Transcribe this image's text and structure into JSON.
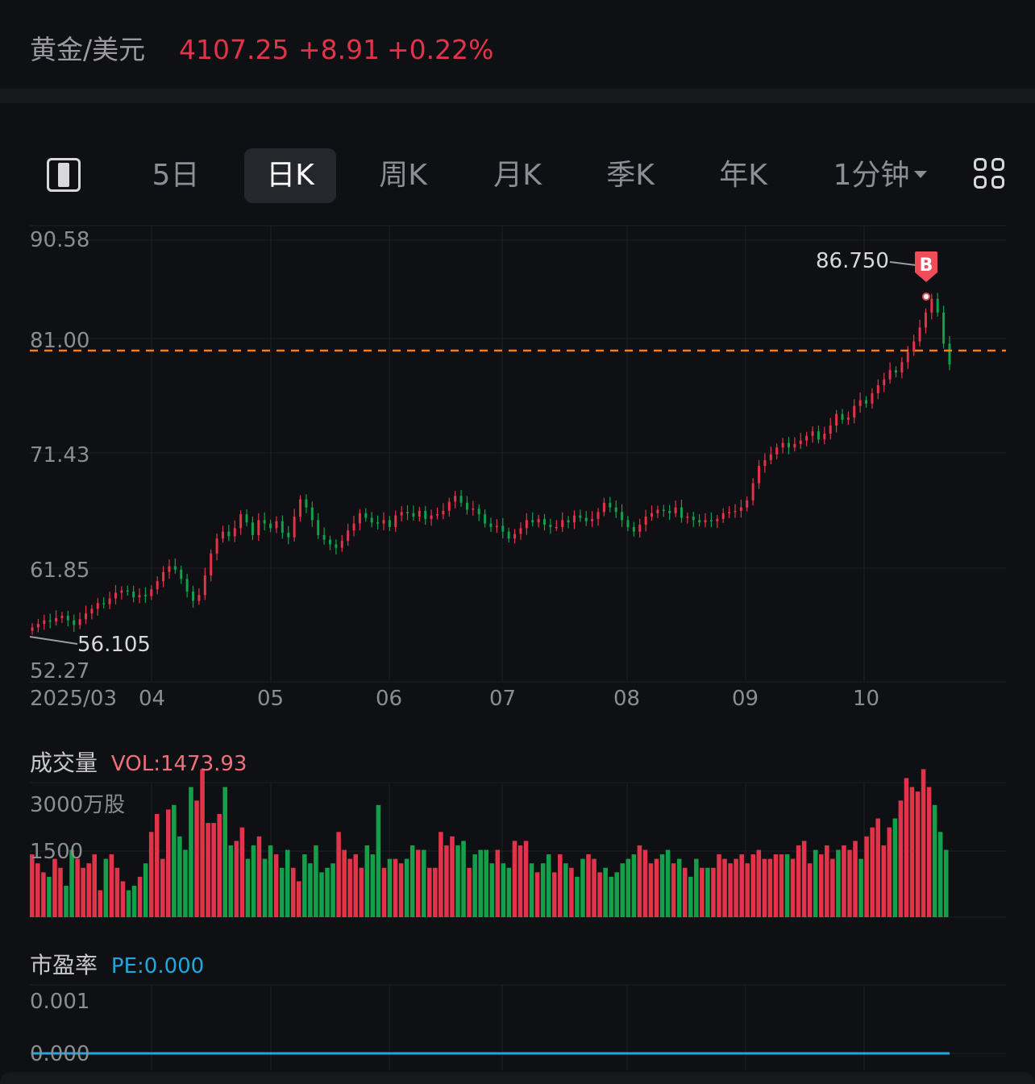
{
  "header": {
    "symbol": "黄金/美元",
    "price": "4107.25",
    "change": "+8.91",
    "change_pct": "+0.22%",
    "colors": {
      "up": "#e2334a",
      "down": "#13a04a",
      "text": "#9a9aa0"
    }
  },
  "tabs": {
    "layout_icon": "split-layout-icon",
    "items": [
      {
        "label": "5日",
        "active": false
      },
      {
        "label": "日K",
        "active": true
      },
      {
        "label": "周K",
        "active": false
      },
      {
        "label": "月K",
        "active": false
      },
      {
        "label": "季K",
        "active": false
      },
      {
        "label": "年K",
        "active": false
      },
      {
        "label": "1分钟",
        "active": false,
        "dropdown": true
      }
    ],
    "more_icon": "grid-icon"
  },
  "price_chart": {
    "y_ticks": [
      "90.58",
      "81.00",
      "71.43",
      "61.85",
      "52.27"
    ],
    "x_ticks": [
      "2025/03",
      "04",
      "05",
      "06",
      "07",
      "08",
      "09",
      "10"
    ],
    "max_label": "86.750",
    "min_label": "56.105",
    "current_line": 81.0,
    "marker": "B"
  },
  "volume": {
    "title": "成交量",
    "value_label": "VOL:1473.93",
    "y_ticks": [
      "3000万股",
      "1500"
    ]
  },
  "pe": {
    "title": "市盈率",
    "value_label": "PE:0.000",
    "y_ticks": [
      "0.001",
      "0.000"
    ],
    "line_color": "#1ea8e0"
  },
  "chart_data": {
    "type": "candlestick",
    "y_range": [
      52.27,
      90.58
    ],
    "closes": [
      57.0,
      57.3,
      57.6,
      57.5,
      57.8,
      58.0,
      57.6,
      57.2,
      57.7,
      58.2,
      58.6,
      59.1,
      59.0,
      59.5,
      60.0,
      60.2,
      60.1,
      59.6,
      59.8,
      59.7,
      60.3,
      61.0,
      61.8,
      62.3,
      62.0,
      61.2,
      60.1,
      59.3,
      59.8,
      61.5,
      63.4,
      64.7,
      65.3,
      64.9,
      65.6,
      66.8,
      66.1,
      65.0,
      66.3,
      66.0,
      65.6,
      66.2,
      65.2,
      64.8,
      66.6,
      68.1,
      67.4,
      66.3,
      65.0,
      64.6,
      64.2,
      63.9,
      64.5,
      65.4,
      66.0,
      66.9,
      66.5,
      66.1,
      66.0,
      66.3,
      65.7,
      66.7,
      67.0,
      66.9,
      66.6,
      67.1,
      66.4,
      66.7,
      66.8,
      67.1,
      67.9,
      68.4,
      67.8,
      67.2,
      67.3,
      66.8,
      66.0,
      65.7,
      65.8,
      65.3,
      64.7,
      65.1,
      65.6,
      66.3,
      66.1,
      66.4,
      65.9,
      65.7,
      65.7,
      66.3,
      66.1,
      66.7,
      66.5,
      66.2,
      66.4,
      67.0,
      67.8,
      67.4,
      67.0,
      66.3,
      65.7,
      65.3,
      65.9,
      66.6,
      66.9,
      67.2,
      67.1,
      66.9,
      67.4,
      66.5,
      66.6,
      66.3,
      66.1,
      66.3,
      66.2,
      66.4,
      66.9,
      67.0,
      67.1,
      67.4,
      68.0,
      69.5,
      71.0,
      71.5,
      72.0,
      72.6,
      73.0,
      72.6,
      72.9,
      73.2,
      73.6,
      74.0,
      73.3,
      73.8,
      74.5,
      75.5,
      75.0,
      75.2,
      76.2,
      76.7,
      76.4,
      77.3,
      78.0,
      78.5,
      79.3,
      79.1,
      80.0,
      80.9,
      81.8,
      83.0,
      84.3,
      85.5,
      84.3,
      81.6,
      79.8
    ],
    "volumes": [
      14,
      12,
      10,
      9,
      13,
      11,
      7,
      15,
      13,
      11,
      12,
      14,
      6,
      13,
      14,
      11,
      8,
      6,
      7,
      9,
      12,
      19,
      23,
      13,
      24,
      25,
      18,
      15,
      29,
      26,
      33,
      21,
      21,
      23,
      29,
      16,
      17,
      20,
      13,
      16,
      18,
      13,
      16,
      14,
      11,
      15,
      11,
      8,
      14,
      12,
      16,
      10,
      11,
      12,
      19,
      15,
      13,
      14,
      11,
      16,
      14,
      25,
      11,
      13,
      13,
      12,
      13,
      16,
      15,
      15,
      11,
      11,
      19,
      16,
      18,
      16,
      17,
      11,
      14,
      15,
      15,
      12,
      15,
      12,
      11,
      17,
      16,
      17,
      12,
      10,
      12,
      14,
      10,
      14,
      12,
      11,
      9,
      13,
      14,
      13,
      10,
      11,
      9,
      10,
      12,
      13,
      14,
      16,
      15,
      12,
      13,
      14,
      15,
      12,
      13,
      11,
      9,
      13,
      11,
      11,
      11,
      14,
      13,
      12,
      13,
      14,
      12,
      14,
      15,
      13,
      13,
      14,
      14,
      14,
      13,
      16,
      17,
      12,
      15,
      14,
      16,
      13,
      15,
      16,
      15,
      17,
      13,
      18,
      20,
      22,
      16,
      20,
      22,
      26,
      31,
      29,
      28,
      33,
      29,
      25,
      19,
      15
    ],
    "volume_range": [
      0,
      3000
    ],
    "pe_values": [
      0.0
    ],
    "pe_range": [
      0,
      0.001
    ]
  }
}
